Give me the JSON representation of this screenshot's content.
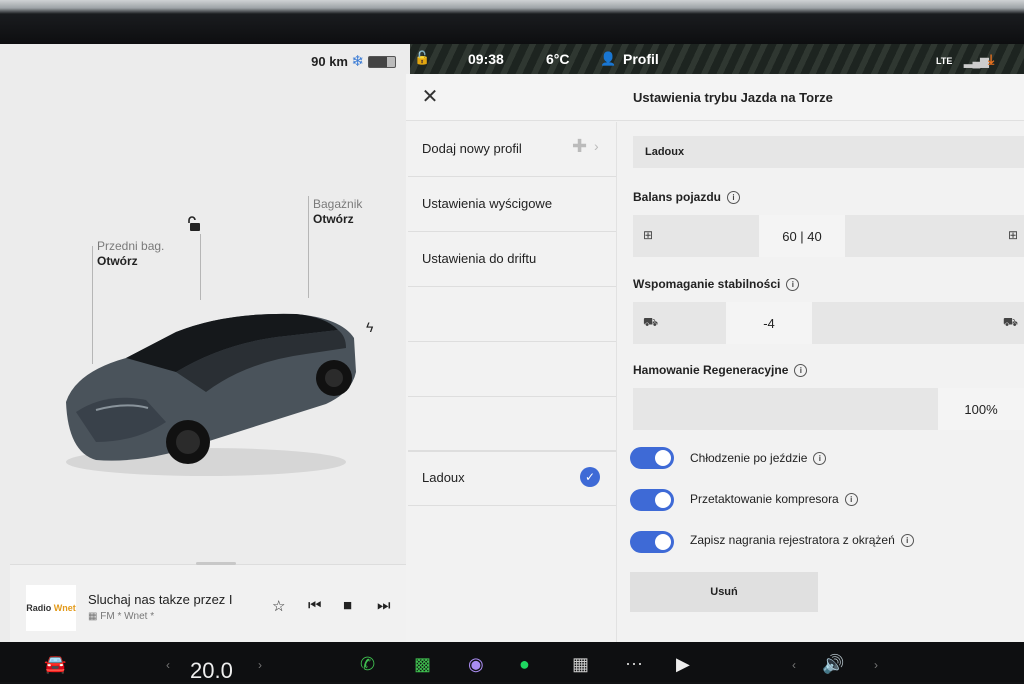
{
  "status": {
    "time": "09:38",
    "temperature": "6°C",
    "profile_label": "Profil",
    "signal": "LTE",
    "range": "90 km"
  },
  "car": {
    "frunk_label": "Przedni bag.",
    "frunk_action": "Otwórz",
    "trunk_label": "Bagażnik",
    "trunk_action": "Otwórz"
  },
  "media": {
    "title": "Sluchaj nas takze przez I",
    "subtitle": "FM * Wnet *",
    "station_logo_a": "Radio",
    "station_logo_b": "Wnet"
  },
  "modal": {
    "title": "Ustawienia trybu Jazda na Torze",
    "profiles": [
      {
        "label": "Dodaj nowy profil"
      },
      {
        "label": "Ustawienia wyścigowe"
      },
      {
        "label": "Ustawienia do driftu"
      },
      {
        "label": ""
      },
      {
        "label": ""
      },
      {
        "label": ""
      },
      {
        "label": "Ladoux",
        "selected": true
      }
    ],
    "profile_name": "Ladoux",
    "balance_label": "Balans pojazdu",
    "balance_value": "60 | 40",
    "stability_label": "Wspomaganie stabilności",
    "stability_value": "-4",
    "regen_label": "Hamowanie Regeneracyjne",
    "regen_value": "100%",
    "toggles": [
      {
        "label": "Chłodzenie po jeździe",
        "on": true
      },
      {
        "label": "Przetaktowanie kompresora",
        "on": true
      },
      {
        "label": "Zapisz nagrania rejestratora z okrążeń",
        "on": true
      }
    ],
    "delete_label": "Usuń"
  },
  "dock": {
    "temperature": "20.0"
  },
  "colors": {
    "accent": "#3e6ad6",
    "panel": "#ececec"
  }
}
